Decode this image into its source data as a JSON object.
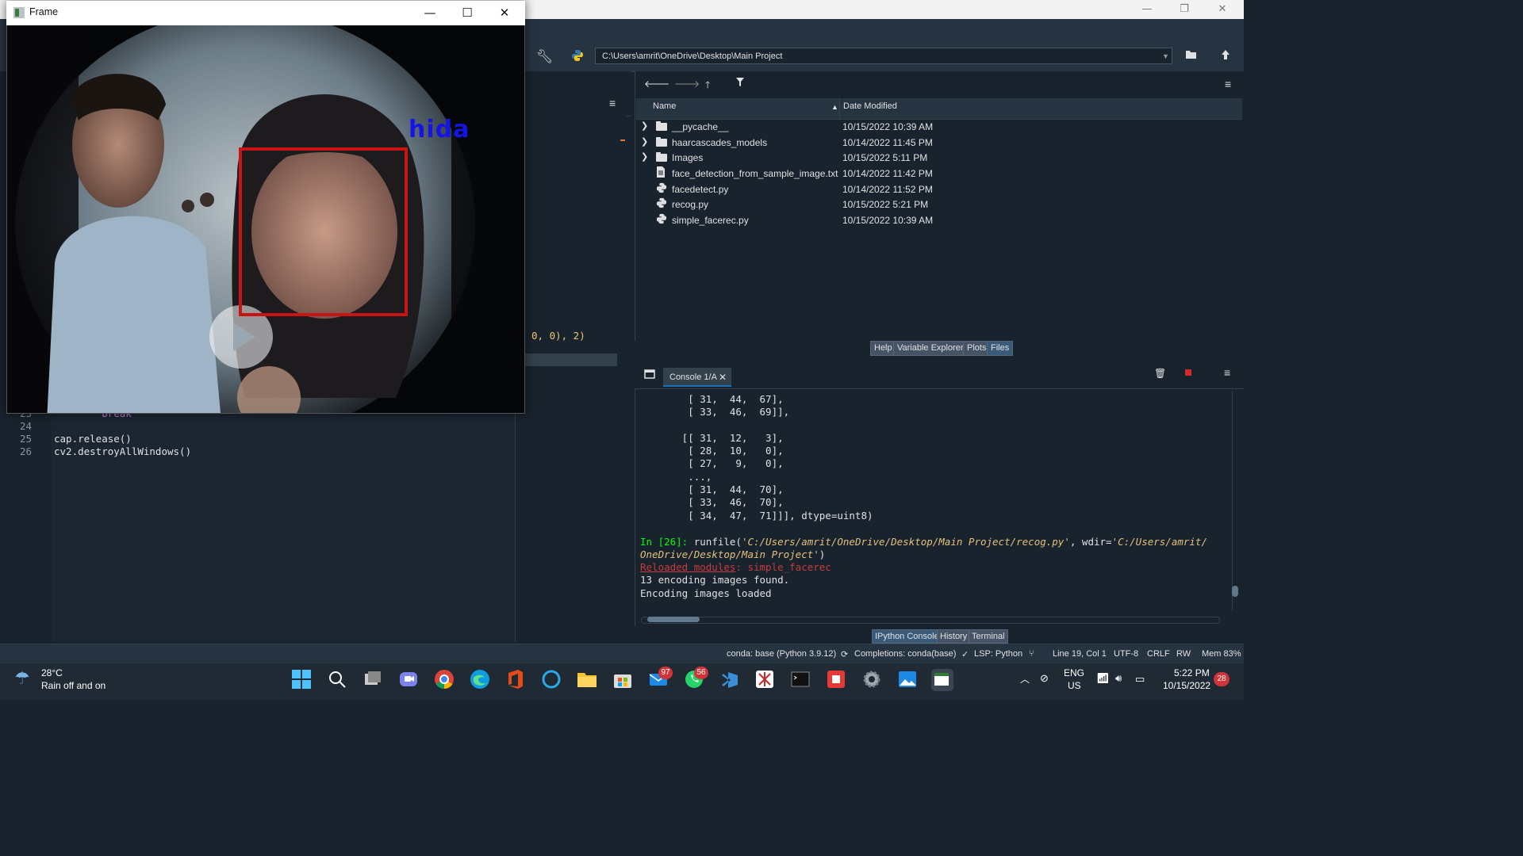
{
  "spyder": {
    "window_controls": [
      "—",
      "❐",
      "✕"
    ],
    "toolbar": {
      "path": "C:\\Users\\amrit\\OneDrive\\Desktop\\Main Project"
    }
  },
  "editor": {
    "lines": [
      {
        "num": "23",
        "code": "        break"
      },
      {
        "num": "24",
        "code": ""
      },
      {
        "num": "25",
        "code": "cap.release()"
      },
      {
        "num": "26",
        "code": "cv2.destroyAllWindows()"
      }
    ],
    "partial_code": "0, 0), 2)"
  },
  "files": {
    "columns": {
      "name": "Name",
      "date": "Date Modified"
    },
    "rows": [
      {
        "type": "folder",
        "name": "__pycache__",
        "date": "10/15/2022 10:39 AM"
      },
      {
        "type": "folder",
        "name": "haarcascades_models",
        "date": "10/14/2022 11:45 PM"
      },
      {
        "type": "folder",
        "name": "Images",
        "date": "10/15/2022 5:11 PM"
      },
      {
        "type": "txt",
        "name": "face_detection_from_sample_image.txt",
        "date": "10/14/2022 11:42 PM"
      },
      {
        "type": "py",
        "name": "facedetect.py",
        "date": "10/14/2022 11:52 PM"
      },
      {
        "type": "py",
        "name": "recog.py",
        "date": "10/15/2022 5:21 PM"
      },
      {
        "type": "py",
        "name": "simple_facerec.py",
        "date": "10/15/2022 10:39 AM"
      }
    ],
    "tabs": [
      "Help",
      "Variable Explorer",
      "Plots",
      "Files"
    ],
    "active_tab": "Files"
  },
  "console": {
    "tab_label": "Console 1/A",
    "output_lines": [
      "        [ 31,  44,  67],",
      "        [ 33,  46,  69]],",
      "",
      "       [[ 31,  12,   3],",
      "        [ 28,  10,   0],",
      "        [ 27,   9,   0],",
      "        ...,",
      "        [ 31,  44,  70],",
      "        [ 33,  46,  70],",
      "        [ 34,  47,  71]]], dtype=uint8)"
    ],
    "prompt": "In [26]:",
    "run_cmd": " runfile(",
    "run_path1": "'C:/Users/amrit/OneDrive/Desktop/Main Project/recog.py'",
    "run_mid": ", wdir=",
    "run_path2a": "'C:/Users/amrit/",
    "run_path2b": "OneDrive/Desktop/Main Project'",
    "run_end": ")",
    "reloaded_label": "Reloaded modules",
    "reloaded_rest": ": simple_facerec",
    "msg1": "13 encoding images found.",
    "msg2": "Encoding images loaded",
    "tabs": [
      "IPython Console",
      "History",
      "Terminal"
    ],
    "active_tab": "IPython Console"
  },
  "statusbar": {
    "env": "conda: base (Python 3.9.12)",
    "completions": "Completions: conda(base)",
    "lsp": "LSP: Python",
    "position": "Line 19, Col 1",
    "encoding": "UTF-8",
    "eol": "CRLF",
    "perm": "RW",
    "mem": "Mem 83%"
  },
  "frame_window": {
    "title": "Frame",
    "label": "hida",
    "label_color": "#1414e6",
    "box_color": "#c81414"
  },
  "taskbar": {
    "weather_temp": "28°C",
    "weather_desc": "Rain off and on",
    "mail_badge": "97",
    "whatsapp_badge": "56",
    "lang": "ENG",
    "region": "US",
    "time": "5:22 PM",
    "date": "10/15/2022",
    "notification_count": "28"
  },
  "colors": {
    "accent": "#1a72bb",
    "bg": "#19232d",
    "prompt": "#00ff00"
  }
}
